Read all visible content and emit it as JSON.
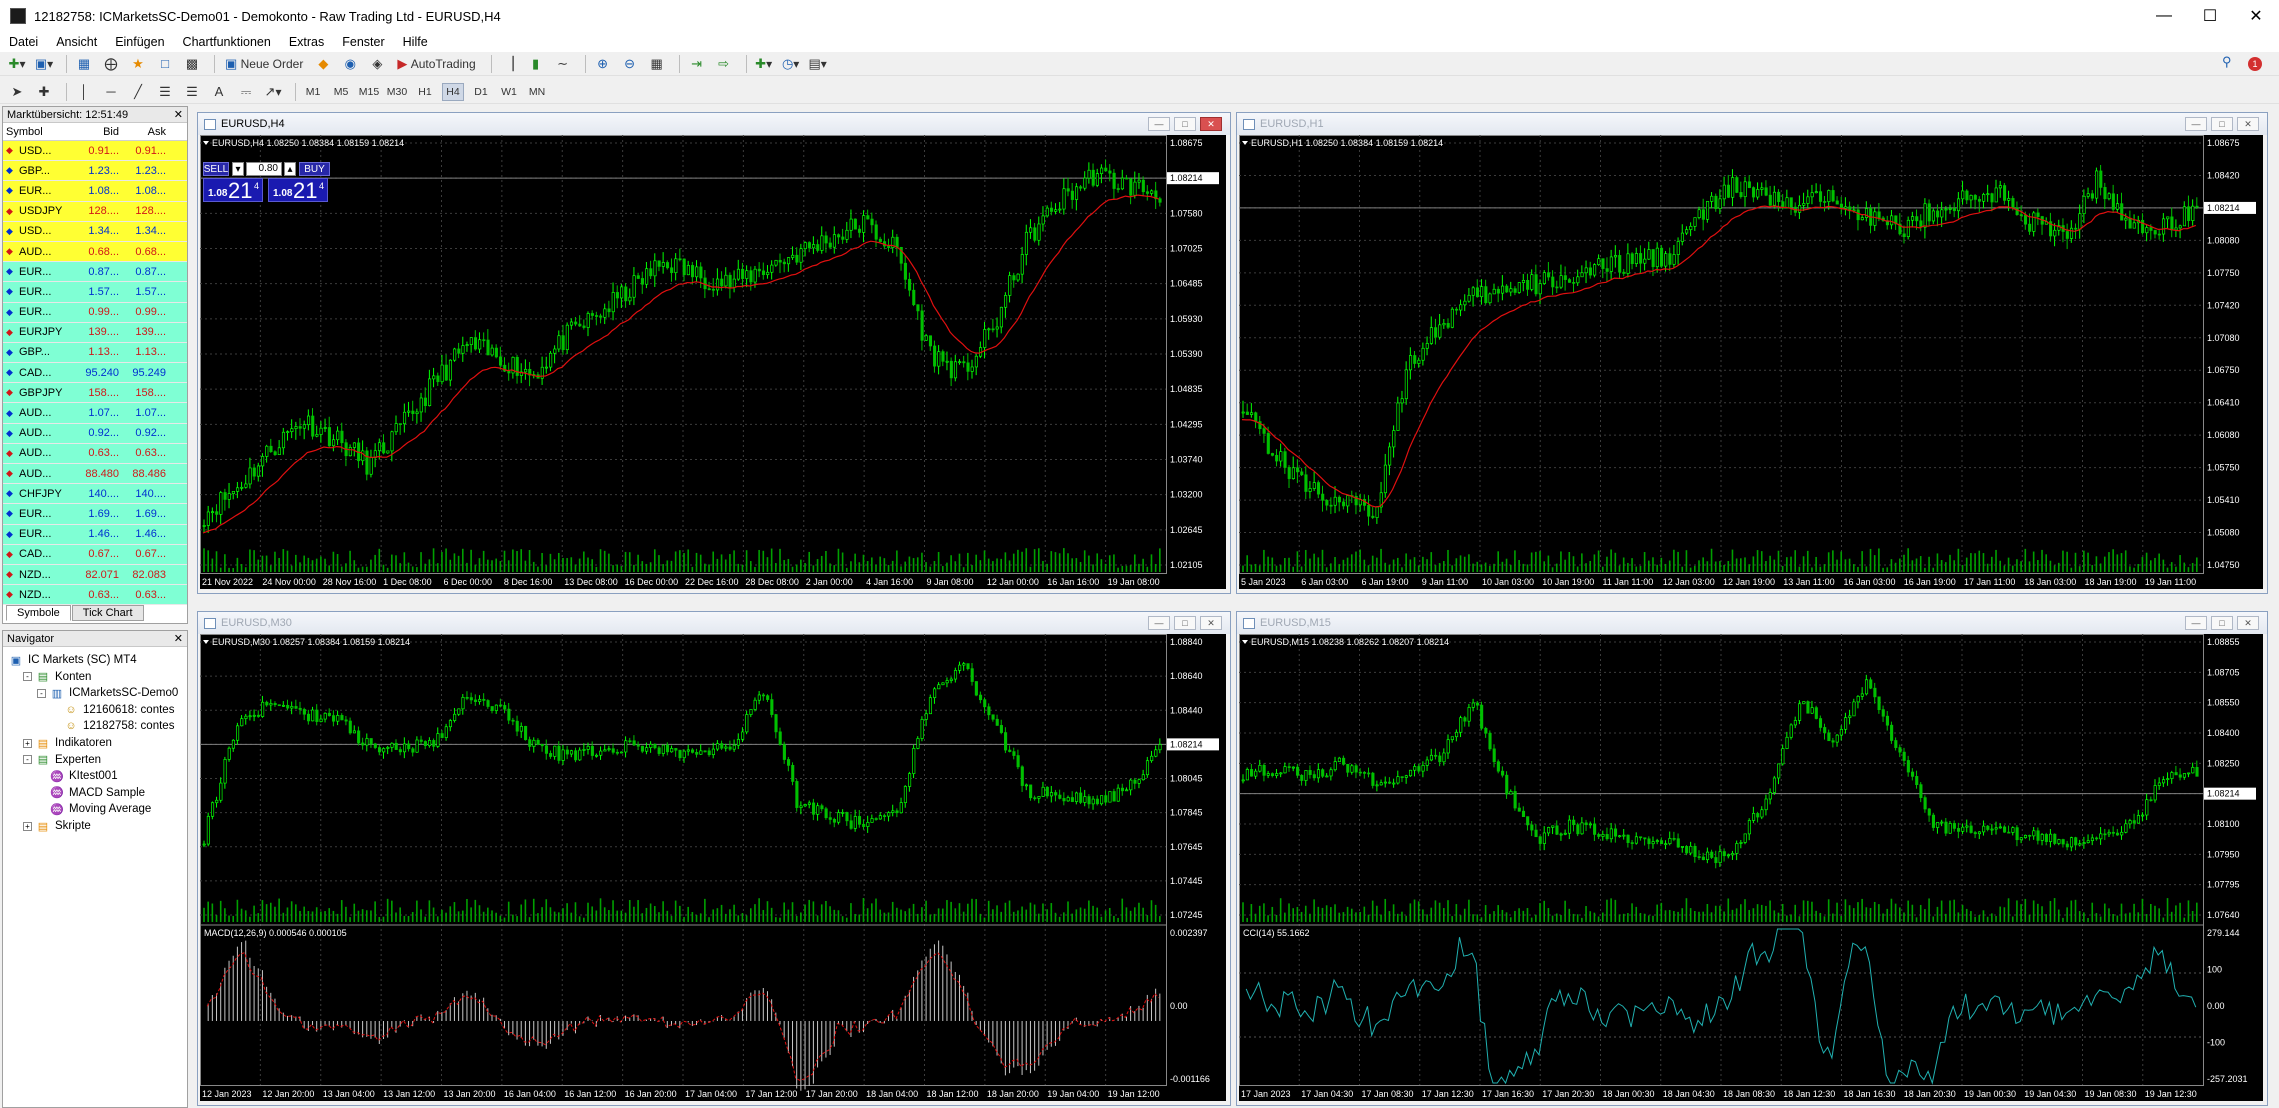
{
  "window": {
    "title": "12182758: ICMarketsSC-Demo01 - Demokonto - Raw Trading Ltd - EURUSD,H4"
  },
  "menu": [
    "Datei",
    "Ansicht",
    "Einfügen",
    "Chartfunktionen",
    "Extras",
    "Fenster",
    "Hilfe"
  ],
  "toolbar": {
    "new_order": "Neue Order",
    "autotrading": "AutoTrading"
  },
  "timeframes": [
    "M1",
    "M5",
    "M15",
    "M30",
    "H1",
    "H4",
    "D1",
    "W1",
    "MN"
  ],
  "active_timeframe": "H4",
  "notification_count": "1",
  "market_watch": {
    "title": "Marktübersicht: 12:51:49",
    "col_symbol": "Symbol",
    "col_bid": "Bid",
    "col_ask": "Ask",
    "rows": [
      {
        "symbol": "USD...",
        "bid": "0.91...",
        "ask": "0.91...",
        "bg": "yellow",
        "dir": "down",
        "color": "red"
      },
      {
        "symbol": "GBP...",
        "bid": "1.23...",
        "ask": "1.23...",
        "bg": "yellow",
        "dir": "up",
        "color": "blue"
      },
      {
        "symbol": "EUR...",
        "bid": "1.08...",
        "ask": "1.08...",
        "bg": "yellow",
        "dir": "up",
        "color": "blue"
      },
      {
        "symbol": "USDJPY",
        "bid": "128....",
        "ask": "128....",
        "bg": "yellow",
        "dir": "down",
        "color": "red"
      },
      {
        "symbol": "USD...",
        "bid": "1.34...",
        "ask": "1.34...",
        "bg": "yellow",
        "dir": "up",
        "color": "blue"
      },
      {
        "symbol": "AUD...",
        "bid": "0.68...",
        "ask": "0.68...",
        "bg": "yellow",
        "dir": "down",
        "color": "red"
      },
      {
        "symbol": "EUR...",
        "bid": "0.87...",
        "ask": "0.87...",
        "bg": "cyan",
        "dir": "up",
        "color": "blue"
      },
      {
        "symbol": "EUR...",
        "bid": "1.57...",
        "ask": "1.57...",
        "bg": "cyan",
        "dir": "up",
        "color": "blue"
      },
      {
        "symbol": "EUR...",
        "bid": "0.99...",
        "ask": "0.99...",
        "bg": "cyan",
        "dir": "up",
        "color": "red"
      },
      {
        "symbol": "EURJPY",
        "bid": "139....",
        "ask": "139....",
        "bg": "cyan",
        "dir": "down",
        "color": "red"
      },
      {
        "symbol": "GBP...",
        "bid": "1.13...",
        "ask": "1.13...",
        "bg": "cyan",
        "dir": "up",
        "color": "red"
      },
      {
        "symbol": "CAD...",
        "bid": "95.240",
        "ask": "95.249",
        "bg": "cyan",
        "dir": "up",
        "color": "blue"
      },
      {
        "symbol": "GBPJPY",
        "bid": "158....",
        "ask": "158....",
        "bg": "cyan",
        "dir": "down",
        "color": "red"
      },
      {
        "symbol": "AUD...",
        "bid": "1.07...",
        "ask": "1.07...",
        "bg": "cyan",
        "dir": "up",
        "color": "blue"
      },
      {
        "symbol": "AUD...",
        "bid": "0.92...",
        "ask": "0.92...",
        "bg": "cyan",
        "dir": "up",
        "color": "blue"
      },
      {
        "symbol": "AUD...",
        "bid": "0.63...",
        "ask": "0.63...",
        "bg": "cyan",
        "dir": "down",
        "color": "red"
      },
      {
        "symbol": "AUD...",
        "bid": "88.480",
        "ask": "88.486",
        "bg": "cyan",
        "dir": "down",
        "color": "red"
      },
      {
        "symbol": "CHFJPY",
        "bid": "140....",
        "ask": "140....",
        "bg": "cyan",
        "dir": "up",
        "color": "blue"
      },
      {
        "symbol": "EUR...",
        "bid": "1.69...",
        "ask": "1.69...",
        "bg": "cyan",
        "dir": "up",
        "color": "blue"
      },
      {
        "symbol": "EUR...",
        "bid": "1.46...",
        "ask": "1.46...",
        "bg": "cyan",
        "dir": "up",
        "color": "blue"
      },
      {
        "symbol": "CAD...",
        "bid": "0.67...",
        "ask": "0.67...",
        "bg": "cyan",
        "dir": "down",
        "color": "red"
      },
      {
        "symbol": "NZD...",
        "bid": "82.071",
        "ask": "82.083",
        "bg": "cyan",
        "dir": "down",
        "color": "red"
      },
      {
        "symbol": "NZD...",
        "bid": "0.63...",
        "ask": "0.63...",
        "bg": "cyan",
        "dir": "down",
        "color": "red"
      }
    ],
    "tabs": [
      "Symbole",
      "Tick Chart"
    ]
  },
  "navigator": {
    "title": "Navigator",
    "items": [
      {
        "label": "IC Markets (SC) MT4",
        "level": 0,
        "icon": "terminal-icon",
        "exp": ""
      },
      {
        "label": "Konten",
        "level": 1,
        "icon": "accounts-folder-icon",
        "exp": "-"
      },
      {
        "label": "ICMarketsSC-Demo0",
        "level": 2,
        "icon": "server-icon",
        "exp": "-"
      },
      {
        "label": "12160618: contes",
        "level": 3,
        "icon": "account-icon",
        "exp": ""
      },
      {
        "label": "12182758: contes",
        "level": 3,
        "icon": "account-icon",
        "exp": ""
      },
      {
        "label": "Indikatoren",
        "level": 1,
        "icon": "indicators-folder-icon",
        "exp": "+"
      },
      {
        "label": "Experten",
        "level": 1,
        "icon": "experts-folder-icon",
        "exp": "-"
      },
      {
        "label": "KItest001",
        "level": 2,
        "icon": "expert-icon",
        "exp": ""
      },
      {
        "label": "MACD Sample",
        "level": 2,
        "icon": "expert-icon",
        "exp": ""
      },
      {
        "label": "Moving Average",
        "level": 2,
        "icon": "expert-icon",
        "exp": ""
      },
      {
        "label": "Skripte",
        "level": 1,
        "icon": "scripts-folder-icon",
        "exp": "+"
      }
    ]
  },
  "one_click": {
    "sell": "SELL",
    "buy": "BUY",
    "lot": "0.80",
    "sell_small": "1.08",
    "sell_big": "21",
    "sell_sup": "4",
    "buy_small": "1.08",
    "buy_big": "21",
    "buy_sup": "4"
  },
  "charts": [
    {
      "id": "h4",
      "title": "EURUSD,H4",
      "active": true,
      "ohlc": "EURUSD,H4  1.08250 1.08384 1.08159 1.08214",
      "price_labels": [
        "1.08675",
        "1.08214",
        "1.07580",
        "1.07025",
        "1.06485",
        "1.05930",
        "1.05390",
        "1.04835",
        "1.04295",
        "1.03740",
        "1.03200",
        "1.02645",
        "1.02105"
      ],
      "current_price": "1.08214",
      "time_labels": [
        "21 Nov 2022",
        "24 Nov 00:00",
        "28 Nov 16:00",
        "1 Dec 08:00",
        "6 Dec 00:00",
        "8 Dec 16:00",
        "13 Dec 08:00",
        "16 Dec 00:00",
        "22 Dec 16:00",
        "28 Dec 08:00",
        "2 Jan 00:00",
        "4 Jan 16:00",
        "9 Jan 08:00",
        "12 Jan 00:00",
        "16 Jan 16:00",
        "19 Jan 08:00"
      ],
      "shape": [
        0.05,
        0.12,
        0.22,
        0.3,
        0.25,
        0.18,
        0.28,
        0.4,
        0.5,
        0.46,
        0.42,
        0.52,
        0.58,
        0.65,
        0.72,
        0.68,
        0.66,
        0.7,
        0.74,
        0.78,
        0.82,
        0.75,
        0.48,
        0.42,
        0.55,
        0.78,
        0.88,
        0.95,
        0.92,
        0.9
      ]
    },
    {
      "id": "h1",
      "title": "EURUSD,H1",
      "active": false,
      "ohlc": "EURUSD,H1  1.08250 1.08384 1.08159 1.08214",
      "price_labels": [
        "1.08675",
        "1.08420",
        "1.08214",
        "1.08080",
        "1.07750",
        "1.07420",
        "1.07080",
        "1.06750",
        "1.06410",
        "1.06080",
        "1.05750",
        "1.05410",
        "1.05080",
        "1.04750"
      ],
      "current_price": "1.08214",
      "time_labels": [
        "5 Jan 2023",
        "6 Jan 03:00",
        "6 Jan 19:00",
        "9 Jan 11:00",
        "10 Jan 03:00",
        "10 Jan 19:00",
        "11 Jan 11:00",
        "12 Jan 03:00",
        "12 Jan 19:00",
        "13 Jan 11:00",
        "16 Jan 03:00",
        "16 Jan 19:00",
        "17 Jan 11:00",
        "18 Jan 03:00",
        "18 Jan 19:00",
        "19 Jan 11:00"
      ],
      "shape": [
        0.35,
        0.2,
        0.12,
        0.08,
        0.05,
        0.45,
        0.55,
        0.62,
        0.64,
        0.66,
        0.68,
        0.7,
        0.72,
        0.74,
        0.85,
        0.92,
        0.88,
        0.86,
        0.9,
        0.84,
        0.8,
        0.86,
        0.88,
        0.9,
        0.82,
        0.78,
        0.94,
        0.8,
        0.82,
        0.86
      ]
    },
    {
      "id": "m30",
      "title": "EURUSD,M30",
      "active": false,
      "ohlc": "EURUSD,M30  1.08257 1.08384 1.08159 1.08214",
      "price_labels": [
        "1.08840",
        "1.08640",
        "1.08440",
        "1.08214",
        "1.08045",
        "1.07845",
        "1.07645",
        "1.07445",
        "1.07245"
      ],
      "current_price": "1.08214",
      "sub_title": "MACD(12,26,9)  0.000546 0.000105",
      "sub_labels": [
        "0.002397",
        "0.00",
        "-0.001166"
      ],
      "time_labels": [
        "12 Jan 2023",
        "12 Jan 20:00",
        "13 Jan 04:00",
        "13 Jan 12:00",
        "13 Jan 20:00",
        "16 Jan 04:00",
        "16 Jan 12:00",
        "16 Jan 20:00",
        "17 Jan 04:00",
        "17 Jan 12:00",
        "17 Jan 20:00",
        "18 Jan 04:00",
        "18 Jan 12:00",
        "18 Jan 20:00",
        "19 Jan 04:00",
        "19 Jan 12:00"
      ],
      "shape": [
        0.2,
        0.7,
        0.78,
        0.74,
        0.72,
        0.6,
        0.58,
        0.62,
        0.82,
        0.76,
        0.6,
        0.55,
        0.58,
        0.6,
        0.58,
        0.56,
        0.6,
        0.85,
        0.35,
        0.3,
        0.25,
        0.3,
        0.8,
        0.95,
        0.7,
        0.4,
        0.38,
        0.36,
        0.4,
        0.58
      ]
    },
    {
      "id": "m15",
      "title": "EURUSD,M15",
      "active": false,
      "ohlc": "EURUSD,M15  1.08238 1.08262 1.08207 1.08214",
      "price_labels": [
        "1.08855",
        "1.08705",
        "1.08550",
        "1.08400",
        "1.08250",
        "1.08214",
        "1.08100",
        "1.07950",
        "1.07795",
        "1.07640"
      ],
      "current_price": "1.08214",
      "sub_title": "CCI(14)  55.1662",
      "sub_labels": [
        "279.144",
        "100",
        "0.00",
        "-100",
        "-257.2031"
      ],
      "time_labels": [
        "17 Jan 2023",
        "17 Jan 04:30",
        "17 Jan 08:30",
        "17 Jan 12:30",
        "17 Jan 16:30",
        "17 Jan 20:30",
        "18 Jan 00:30",
        "18 Jan 04:30",
        "18 Jan 08:30",
        "18 Jan 12:30",
        "18 Jan 16:30",
        "18 Jan 20:30",
        "19 Jan 00:30",
        "19 Jan 04:30",
        "19 Jan 08:30",
        "19 Jan 12:30"
      ],
      "shape": [
        0.48,
        0.5,
        0.46,
        0.52,
        0.44,
        0.48,
        0.55,
        0.8,
        0.4,
        0.2,
        0.25,
        0.22,
        0.2,
        0.18,
        0.1,
        0.15,
        0.4,
        0.8,
        0.6,
        0.9,
        0.55,
        0.25,
        0.22,
        0.24,
        0.2,
        0.18,
        0.22,
        0.25,
        0.45,
        0.48
      ]
    }
  ],
  "colors": {
    "bull": "#00ff00",
    "bear": "#00c000",
    "ma": "#e01010",
    "grid": "#3c3c3c",
    "bg": "#000000",
    "axis_text": "#ffffff",
    "volume": "#00a000",
    "macd_signal": "#e01010",
    "cci": "#20b0b0"
  }
}
